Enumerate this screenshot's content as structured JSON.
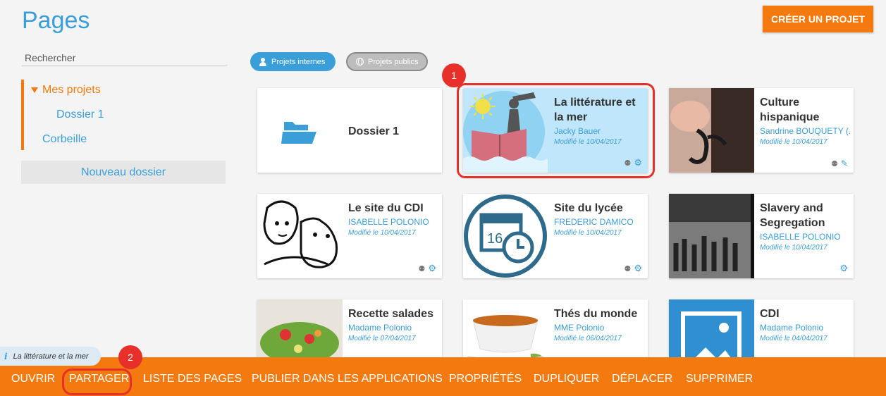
{
  "header": {
    "title": "Pages",
    "create_button": "CRÉER UN PROJET"
  },
  "sidebar": {
    "search_placeholder": "Rechercher",
    "tree": {
      "my_projects": "Mes projets",
      "folder": "Dossier 1",
      "trash": "Corbeille"
    },
    "new_folder_button": "Nouveau dossier"
  },
  "filters": {
    "internal": "Projets internes",
    "public": "Projets publics"
  },
  "cards": [
    {
      "title": "Dossier 1",
      "owner": "",
      "date": ""
    },
    {
      "title": "La littérature et la mer",
      "owner": "Jacky Bauer",
      "date": "Modifié le 10/04/2017"
    },
    {
      "title": "Culture hispanique",
      "owner": "Sandrine BOUQUETY (...",
      "date": "Modifié le 10/04/2017"
    },
    {
      "title": "Le site du CDI",
      "owner": "ISABELLE POLONIO",
      "date": "Modifié le 10/04/2017"
    },
    {
      "title": "Site du lycée",
      "owner": "FREDERIC DAMICO",
      "date": "Modifié le 10/04/2017"
    },
    {
      "title": "Slavery and Segregation",
      "owner": "ISABELLE POLONIO",
      "date": "Modifié le 10/04/2017"
    },
    {
      "title": "Recette salades",
      "owner": "Madame Polonio",
      "date": "Modifié le 07/04/2017"
    },
    {
      "title": "Thés du monde",
      "owner": "MME Polonio",
      "date": "Modifié le 06/04/2017"
    },
    {
      "title": "CDI",
      "owner": "Madame Polonio",
      "date": "Modifié le 04/04/2017"
    }
  ],
  "calendar_day": "16",
  "callouts": {
    "one": "1",
    "two": "2"
  },
  "info_chip": "La littérature et la mer",
  "actions": {
    "open": "OUVRIR",
    "share": "PARTAGER",
    "page_list": "LISTE DES PAGES",
    "publish": "PUBLIER DANS LES APPLICATIONS",
    "properties": "PROPRIÉTÉS",
    "duplicate": "DUPLIQUER",
    "move": "DÉPLACER",
    "delete": "SUPPRIMER"
  },
  "colors": {
    "accent_blue": "#3a9ed9",
    "accent_orange": "#f47a10",
    "highlight_red": "#e8302a"
  }
}
